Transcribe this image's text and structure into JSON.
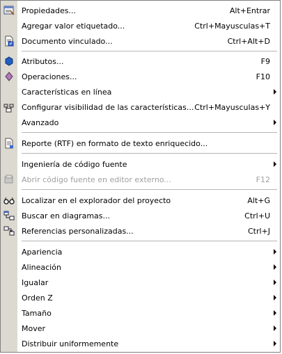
{
  "menu": {
    "items": [
      {
        "label": "Propiedades...",
        "shortcut": "Alt+Entrar",
        "icon": "properties-icon"
      },
      {
        "label": "Agregar valor etiquetado...",
        "shortcut": "Ctrl+Mayusculas+T",
        "icon": ""
      },
      {
        "label": "Documento vinculado...",
        "shortcut": "Ctrl+Alt+D",
        "icon": "linked-document-icon"
      },
      {
        "label": "Atributos...",
        "shortcut": "F9",
        "icon": "attribute-icon"
      },
      {
        "label": "Operaciones...",
        "shortcut": "F10",
        "icon": "operation-icon"
      },
      {
        "label": "Características en línea",
        "shortcut": "",
        "icon": ""
      },
      {
        "label": "Configurar visibilidad de las características...",
        "shortcut": "Ctrl+Mayusculas+Y",
        "icon": "visibility-icon"
      },
      {
        "label": "Avanzado",
        "shortcut": "",
        "icon": ""
      },
      {
        "label": "Reporte (RTF) en formato de texto enriquecido...",
        "shortcut": "",
        "icon": "report-icon"
      },
      {
        "label": "Ingeniería de código fuente",
        "shortcut": "",
        "icon": ""
      },
      {
        "label": "Abrir código fuente en editor externo...",
        "shortcut": "F12",
        "icon": "external-editor-icon"
      },
      {
        "label": "Localizar en el explorador del proyecto",
        "shortcut": "Alt+G",
        "icon": "locate-icon"
      },
      {
        "label": "Buscar en diagramas...",
        "shortcut": "Ctrl+U",
        "icon": "find-diagrams-icon"
      },
      {
        "label": "Referencias personalizadas...",
        "shortcut": "Ctrl+J",
        "icon": "references-icon"
      },
      {
        "label": "Apariencia",
        "shortcut": "",
        "icon": ""
      },
      {
        "label": "Alineación",
        "shortcut": "",
        "icon": ""
      },
      {
        "label": "Igualar",
        "shortcut": "",
        "icon": ""
      },
      {
        "label": "Orden Z",
        "shortcut": "",
        "icon": ""
      },
      {
        "label": "Tamaño",
        "shortcut": "",
        "icon": ""
      },
      {
        "label": "Mover",
        "shortcut": "",
        "icon": ""
      },
      {
        "label": "Distribuir uniformemente",
        "shortcut": "",
        "icon": ""
      }
    ]
  }
}
